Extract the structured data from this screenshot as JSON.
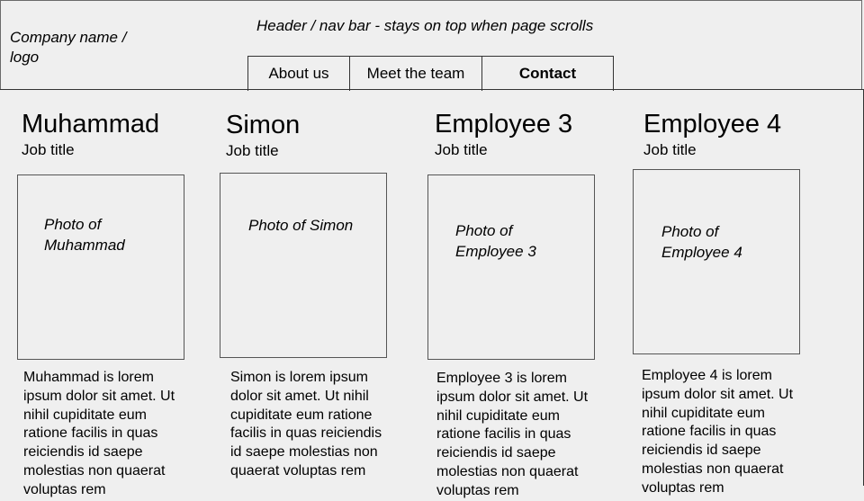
{
  "header": {
    "logo_text": "Company name / logo",
    "note": "Header / nav bar - stays on top when page scrolls",
    "nav": [
      {
        "label": "About us"
      },
      {
        "label": "Meet the team"
      },
      {
        "label": "Contact"
      }
    ]
  },
  "team": [
    {
      "name": "Muhammad",
      "job_title": "Job title",
      "photo_label": "Photo of Muhammad",
      "bio": "Muhammad is lorem ipsum dolor sit amet. Ut nihil cupiditate eum ratione facilis in quas reiciendis id saepe molestias non quaerat voluptas rem"
    },
    {
      "name": "Simon",
      "job_title": "Job title",
      "photo_label": "Photo of Simon",
      "bio": "Simon is lorem ipsum dolor sit amet. Ut nihil cupiditate eum ratione facilis in quas reiciendis id saepe molestias non quaerat voluptas rem"
    },
    {
      "name": "Employee 3",
      "job_title": "Job title",
      "photo_label": "Photo of Employee 3",
      "bio": "Employee 3 is lorem ipsum dolor sit amet. Ut nihil cupiditate eum ratione facilis in quas reiciendis id saepe molestias non quaerat voluptas rem"
    },
    {
      "name": "Employee 4",
      "job_title": "Job title",
      "photo_label": "Photo of Employee 4",
      "bio": "Employee 4 is lorem ipsum dolor sit amet. Ut nihil cupiditate eum ratione facilis in quas reiciendis id saepe molestias non quaerat voluptas rem"
    }
  ]
}
